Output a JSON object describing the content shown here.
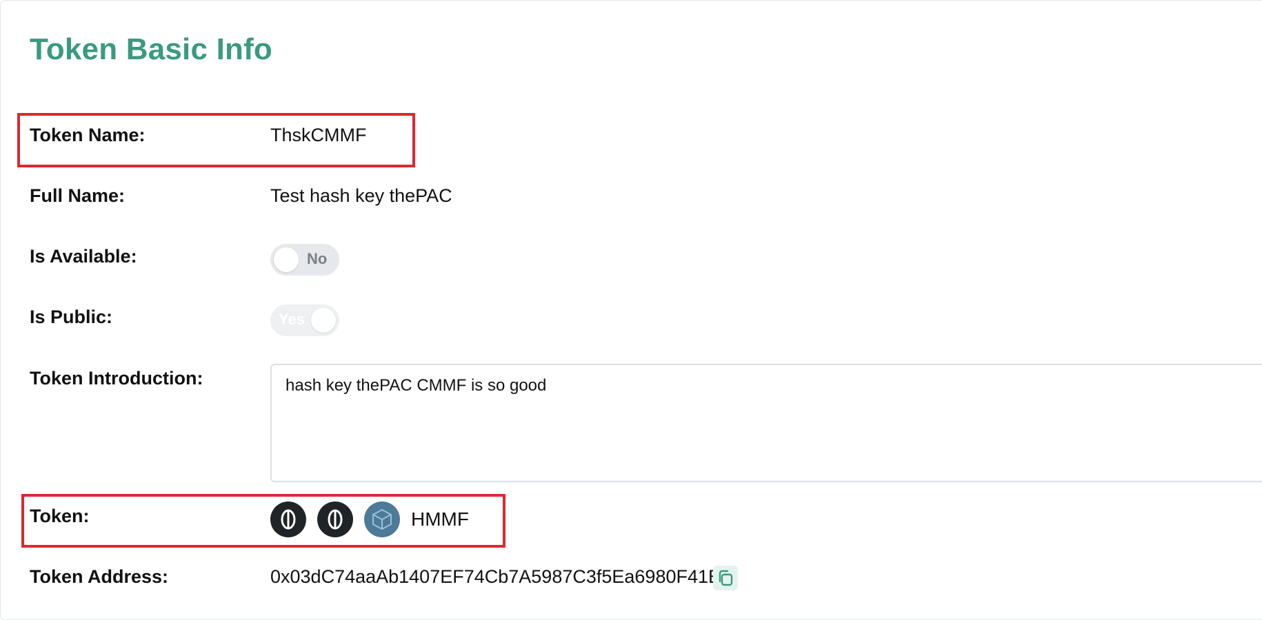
{
  "title": "Token Basic Info",
  "fields": {
    "token_name": {
      "label": "Token Name:",
      "value": "ThskCMMF"
    },
    "full_name": {
      "label": "Full Name:",
      "value": "Test hash key thePAC"
    },
    "is_available": {
      "label": "Is Available:",
      "toggle_text": "No",
      "state": "off"
    },
    "is_public": {
      "label": "Is Public:",
      "toggle_text": "Yes",
      "state": "on"
    },
    "introduction": {
      "label": "Token Introduction:",
      "value": "hash key thePAC CMMF is so good"
    },
    "token": {
      "label": "Token:",
      "symbol": "HMMF",
      "icons": [
        "chain-logo-icon",
        "chain-logo-icon",
        "cube-logo-icon"
      ]
    },
    "address": {
      "label": "Token Address:",
      "value": "0x03dC74aaAb1407EF74Cb7A5987C3f5Ea6980F41E"
    }
  },
  "colors": {
    "title": "#3a9a80",
    "highlight": "#e0262e",
    "copy_icon": "#3a9a80"
  }
}
